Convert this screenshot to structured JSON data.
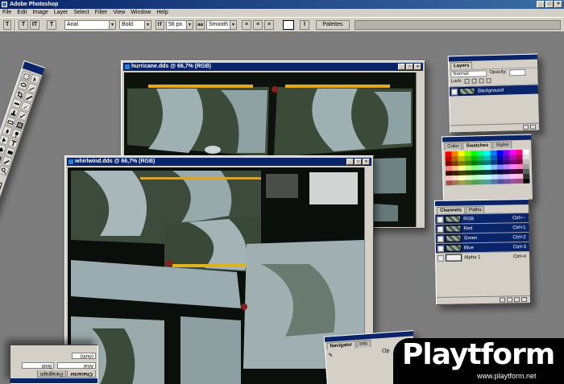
{
  "app": {
    "title": "Adobe Photoshop"
  },
  "menu": [
    "File",
    "Edit",
    "Image",
    "Layer",
    "Select",
    "Filter",
    "View",
    "Window",
    "Help"
  ],
  "options_bar": {
    "font_family": "Arial",
    "font_style": "Bold",
    "font_size": "56 px",
    "antialias": "Smooth",
    "palettes_button": "Palettes"
  },
  "documents": [
    {
      "title": "hurricane.dds @ 66,7% (RGB)"
    },
    {
      "title": "whirlwind.dds @ 66,7% (RGB)"
    }
  ],
  "layers_palette": {
    "tab": "Layers",
    "blend_mode": "Normal",
    "opacity_label": "Opacity:",
    "lock_label": "Lock:",
    "layer_name": "Background"
  },
  "swatches_palette": {
    "tabs": [
      "Color",
      "Swatches",
      "Styles"
    ],
    "colors": [
      "#ff0000",
      "#ff8000",
      "#ffff00",
      "#80ff00",
      "#00ff00",
      "#00ff80",
      "#00ffff",
      "#0080ff",
      "#0000ff",
      "#8000ff",
      "#ff00ff",
      "#ff0080",
      "#ffffff",
      "#c00000",
      "#c06000",
      "#c0c000",
      "#60c000",
      "#00c000",
      "#00c060",
      "#00c0c0",
      "#0060c0",
      "#0000c0",
      "#6000c0",
      "#c000c0",
      "#c00060",
      "#e0e0e0",
      "#800000",
      "#804000",
      "#808000",
      "#408000",
      "#008000",
      "#008040",
      "#008080",
      "#004080",
      "#000080",
      "#400080",
      "#800080",
      "#800040",
      "#c0c0c0",
      "#ff8080",
      "#ffc080",
      "#ffff80",
      "#c0ff80",
      "#80ff80",
      "#80ffc0",
      "#80ffff",
      "#80c0ff",
      "#8080ff",
      "#c080ff",
      "#ff80ff",
      "#ff80c0",
      "#a0a0a0",
      "#400000",
      "#402000",
      "#404000",
      "#204000",
      "#004000",
      "#004020",
      "#004040",
      "#002040",
      "#000040",
      "#200040",
      "#400040",
      "#400020",
      "#606060",
      "#ffc0c0",
      "#ffe0c0",
      "#ffffc0",
      "#e0ffc0",
      "#c0ffc0",
      "#c0ffe0",
      "#c0ffff",
      "#c0e0ff",
      "#c0c0ff",
      "#e0c0ff",
      "#ffc0ff",
      "#ffc0e0",
      "#303030",
      "#a05050",
      "#a07850",
      "#a0a050",
      "#78a050",
      "#50a050",
      "#50a078",
      "#50a0a0",
      "#5078a0",
      "#5050a0",
      "#7850a0",
      "#a050a0",
      "#a05078",
      "#000000"
    ]
  },
  "channels_palette": {
    "tabs": [
      "Channels",
      "Paths"
    ],
    "channels": [
      {
        "name": "RGB",
        "shortcut": "Ctrl+~"
      },
      {
        "name": "Red",
        "shortcut": "Ctrl+1"
      },
      {
        "name": "Green",
        "shortcut": "Ctrl+2"
      },
      {
        "name": "Blue",
        "shortcut": "Ctrl+3"
      },
      {
        "name": "Alpha 1",
        "shortcut": "Ctrl+4"
      }
    ]
  },
  "navigator_palette": {
    "tabs": [
      "Navigator",
      "Info"
    ],
    "op_label": "Op"
  },
  "character_palette": {
    "tabs": [
      "Character",
      "Paragraph"
    ],
    "font": "Arial",
    "style": "Bold",
    "size_value": "(Auto)"
  },
  "watermark": {
    "brand": "Playtform",
    "url": "www.playtform.net"
  }
}
